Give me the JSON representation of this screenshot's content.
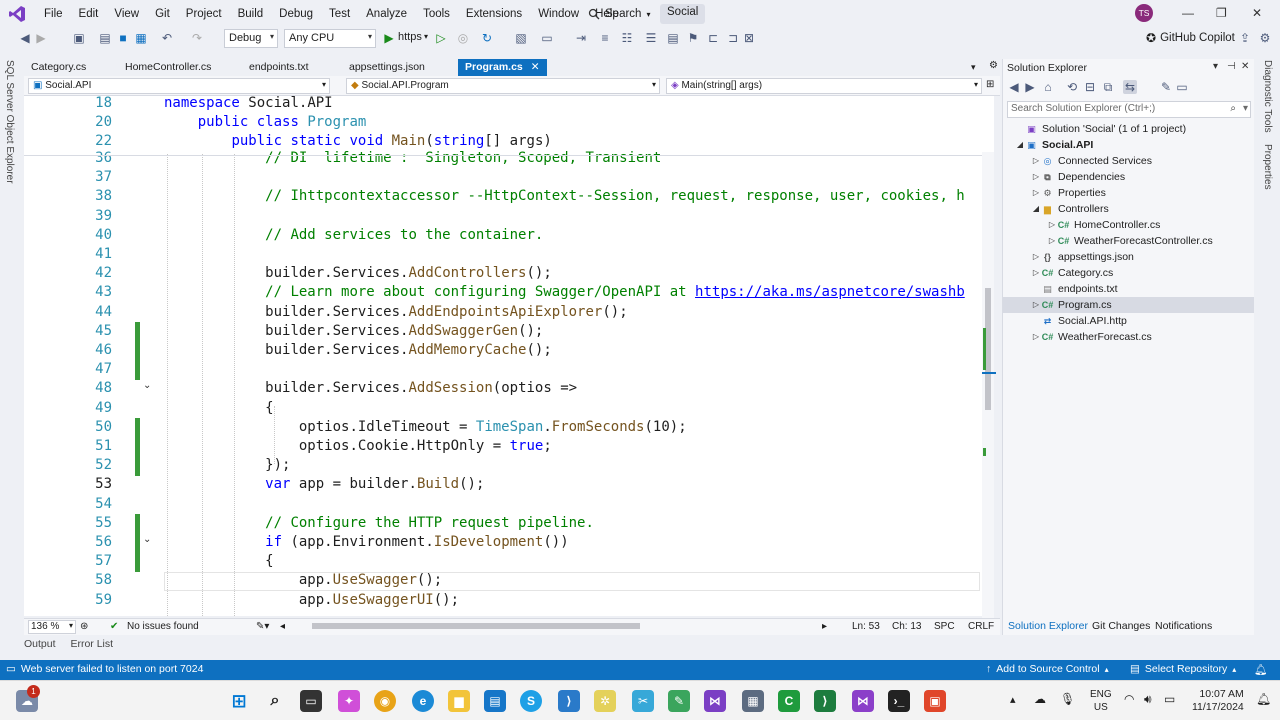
{
  "menubar": {
    "items": [
      "File",
      "Edit",
      "View",
      "Git",
      "Project",
      "Build",
      "Debug",
      "Test",
      "Analyze",
      "Tools",
      "Extensions",
      "Window",
      "Help"
    ],
    "search_label": "Search",
    "solution_name": "Social",
    "avatar_initials": "TS"
  },
  "toolbar": {
    "configuration": "Debug",
    "platform": "Any CPU",
    "run_profile": "https",
    "copilot_label": "GitHub Copilot"
  },
  "left_strip": {
    "label": "SQL Server Object Explorer"
  },
  "right_strip": {
    "diagnostic_label": "Diagnostic Tools",
    "properties_label": "Properties"
  },
  "tabs": [
    {
      "label": "Category.cs",
      "active": false
    },
    {
      "label": "HomeController.cs",
      "active": false
    },
    {
      "label": "endpoints.txt",
      "active": false
    },
    {
      "label": "appsettings.json",
      "active": false
    },
    {
      "label": "Program.cs",
      "active": true
    }
  ],
  "navbar": {
    "project": "Social.API",
    "type": "Social.API.Program",
    "member": "Main(string[] args)"
  },
  "sticky_lines": [
    {
      "num": "18",
      "code": "namespace Social.API"
    },
    {
      "num": "20",
      "code": "    public class Program"
    },
    {
      "num": "22",
      "code": "        public static void Main(string[] args)"
    }
  ],
  "code_lines": [
    {
      "num": "36",
      "code": "            // DI  lifetime :  Singleton, Scoped, Transient"
    },
    {
      "num": "37",
      "code": ""
    },
    {
      "num": "38",
      "code": "            // Ihttpcontextaccessor --HttpContext--Session, request, response, user, cookies, h"
    },
    {
      "num": "39",
      "code": ""
    },
    {
      "num": "40",
      "code": "            // Add services to the container."
    },
    {
      "num": "41",
      "code": ""
    },
    {
      "num": "42",
      "code": "            builder.Services.AddControllers();"
    },
    {
      "num": "43",
      "code": "            // Learn more about configuring Swagger/OpenAPI at https://aka.ms/aspnetcore/swashb"
    },
    {
      "num": "44",
      "code": "            builder.Services.AddEndpointsApiExplorer();"
    },
    {
      "num": "45",
      "code": "            builder.Services.AddSwaggerGen();"
    },
    {
      "num": "46",
      "code": "            builder.Services.AddMemoryCache();"
    },
    {
      "num": "47",
      "code": ""
    },
    {
      "num": "48",
      "code": "            builder.Services.AddSession(optios =>"
    },
    {
      "num": "49",
      "code": "            {"
    },
    {
      "num": "50",
      "code": "                optios.IdleTimeout = TimeSpan.FromSeconds(10);"
    },
    {
      "num": "51",
      "code": "                optios.Cookie.HttpOnly = true;"
    },
    {
      "num": "52",
      "code": "            });"
    },
    {
      "num": "53",
      "code": "            var app = builder.Build();"
    },
    {
      "num": "54",
      "code": ""
    },
    {
      "num": "55",
      "code": "            // Configure the HTTP request pipeline."
    },
    {
      "num": "56",
      "code": "            if (app.Environment.IsDevelopment())"
    },
    {
      "num": "57",
      "code": "            {"
    },
    {
      "num": "58",
      "code": "                app.UseSwagger();"
    },
    {
      "num": "59",
      "code": "                app.UseSwaggerUI();"
    }
  ],
  "editor_status": {
    "zoom": "136 %",
    "issues": "No issues found",
    "line": "Ln: 53",
    "column": "Ch: 13",
    "whitespace": "SPC",
    "line_ending": "CRLF"
  },
  "output_tabs": [
    "Output",
    "Error List"
  ],
  "statusbar": {
    "message": "Web server failed to listen on port 7024",
    "source_control": "Add to Source Control",
    "repository": "Select Repository"
  },
  "solution_explorer": {
    "title": "Solution Explorer",
    "search_placeholder": "Search Solution Explorer (Ctrl+;)",
    "items": [
      {
        "label": "Solution 'Social' (1 of 1 project)",
        "icon": "solution-icon",
        "arrow": "",
        "indent": 0,
        "selected": false
      },
      {
        "label": "Social.API",
        "icon": "csharp-project-icon",
        "arrow": "expanded",
        "indent": 0,
        "selected": false,
        "bold": true
      },
      {
        "label": "Connected Services",
        "icon": "connected-services-icon",
        "arrow": "collapsed",
        "indent": 1,
        "selected": false
      },
      {
        "label": "Dependencies",
        "icon": "dependencies-icon",
        "arrow": "collapsed",
        "indent": 1,
        "selected": false
      },
      {
        "label": "Properties",
        "icon": "properties-icon",
        "arrow": "collapsed",
        "indent": 1,
        "selected": false
      },
      {
        "label": "Controllers",
        "icon": "folder-icon",
        "arrow": "expanded",
        "indent": 1,
        "selected": false
      },
      {
        "label": "HomeController.cs",
        "icon": "csharp-file-icon",
        "arrow": "collapsed",
        "indent": 2,
        "selected": false
      },
      {
        "label": "WeatherForecastController.cs",
        "icon": "csharp-file-icon",
        "arrow": "collapsed",
        "indent": 2,
        "selected": false
      },
      {
        "label": "appsettings.json",
        "icon": "json-file-icon",
        "arrow": "collapsed",
        "indent": 1,
        "selected": false
      },
      {
        "label": "Category.cs",
        "icon": "csharp-file-icon",
        "arrow": "collapsed",
        "indent": 1,
        "selected": false
      },
      {
        "label": "endpoints.txt",
        "icon": "text-file-icon",
        "arrow": "",
        "indent": 1,
        "selected": false
      },
      {
        "label": "Program.cs",
        "icon": "csharp-file-icon",
        "arrow": "collapsed",
        "indent": 1,
        "selected": true
      },
      {
        "label": "Social.API.http",
        "icon": "http-file-icon",
        "arrow": "",
        "indent": 1,
        "selected": false
      },
      {
        "label": "WeatherForecast.cs",
        "icon": "csharp-file-icon",
        "arrow": "collapsed",
        "indent": 1,
        "selected": false
      }
    ],
    "bottom_tabs": [
      "Solution Explorer",
      "Git Changes",
      "Notifications"
    ]
  },
  "taskbar": {
    "badge_count": "1",
    "language": "ENG",
    "region": "US",
    "time": "10:07 AM",
    "date": "11/17/2024"
  },
  "colors": {
    "accent": "#0e70c0",
    "keyword": "#0000ff",
    "type": "#2b91af",
    "comment": "#008000",
    "method": "#74531f",
    "change_bar": "#3a9b3a"
  }
}
